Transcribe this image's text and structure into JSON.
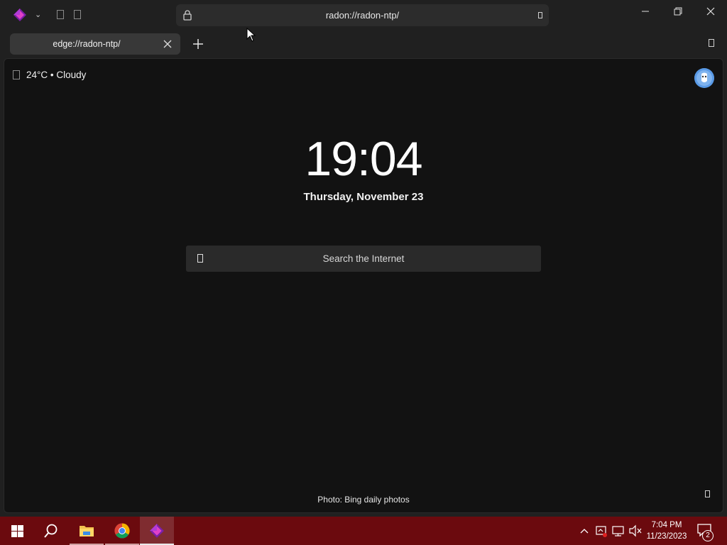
{
  "browser": {
    "address_bar_text": "radon://radon-ntp/",
    "icons": {
      "logo": "radon-logo-icon",
      "profile_chevron": "chevron-down-icon",
      "lock": "lock-icon",
      "minimize": "minimize-icon",
      "restore": "restore-icon",
      "close": "close-icon"
    },
    "accent_color": "#c026d3"
  },
  "tabs": [
    {
      "label": "edge://radon-ntp/",
      "active": true
    }
  ],
  "new_tab_page": {
    "weather_text": "24°C • Cloudy",
    "time": "19:04",
    "date": "Thursday, November 23",
    "search_placeholder": "Search the Internet",
    "photo_credit": "Photo: Bing daily photos",
    "background_color": "#121212"
  },
  "taskbar": {
    "background_color": "#6b0a0e",
    "items": [
      "start-icon",
      "search-icon",
      "file-explorer-icon",
      "chrome-icon",
      "radon-browser-icon"
    ],
    "tray_time": "7:04 PM",
    "tray_date": "11/23/2023",
    "notification_count": "2"
  }
}
